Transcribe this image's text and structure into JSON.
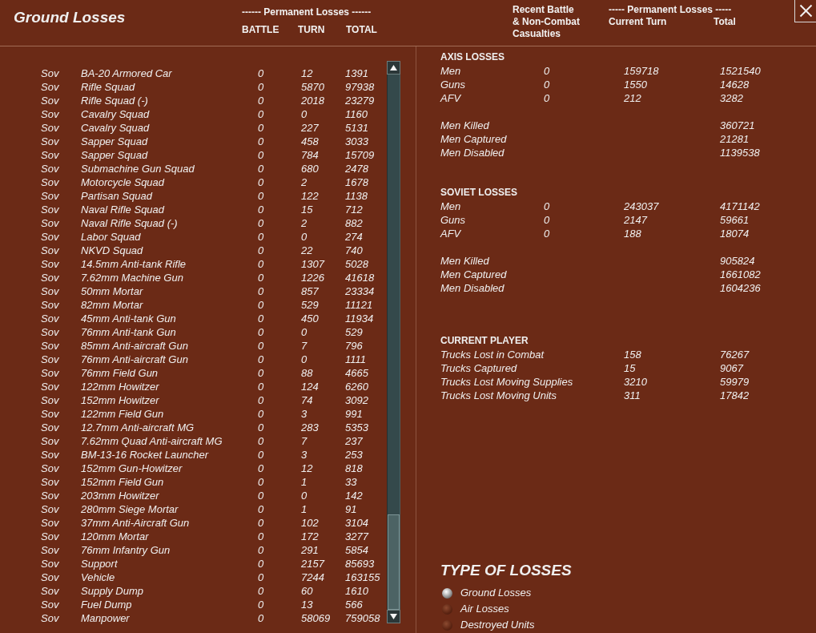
{
  "window": {
    "title": "Ground Losses"
  },
  "unit_losses": {
    "group_label": "------ Permanent Losses ------",
    "columns": [
      "BATTLE",
      "TURN",
      "TOTAL"
    ],
    "rows": [
      {
        "side": "Sov",
        "name": "BA-20 Armored Car",
        "battle": "0",
        "turn": "12",
        "total": "1391"
      },
      {
        "side": "Sov",
        "name": "Rifle Squad",
        "battle": "0",
        "turn": "5870",
        "total": "97938"
      },
      {
        "side": "Sov",
        "name": "Rifle Squad (-)",
        "battle": "0",
        "turn": "2018",
        "total": "23279"
      },
      {
        "side": "Sov",
        "name": "Cavalry Squad",
        "battle": "0",
        "turn": "0",
        "total": "1160"
      },
      {
        "side": "Sov",
        "name": "Cavalry Squad",
        "battle": "0",
        "turn": "227",
        "total": "5131"
      },
      {
        "side": "Sov",
        "name": "Sapper Squad",
        "battle": "0",
        "turn": "458",
        "total": "3033"
      },
      {
        "side": "Sov",
        "name": "Sapper Squad",
        "battle": "0",
        "turn": "784",
        "total": "15709"
      },
      {
        "side": "Sov",
        "name": "Submachine Gun Squad",
        "battle": "0",
        "turn": "680",
        "total": "2478"
      },
      {
        "side": "Sov",
        "name": "Motorcycle Squad",
        "battle": "0",
        "turn": "2",
        "total": "1678"
      },
      {
        "side": "Sov",
        "name": "Partisan Squad",
        "battle": "0",
        "turn": "122",
        "total": "1138"
      },
      {
        "side": "Sov",
        "name": "Naval Rifle Squad",
        "battle": "0",
        "turn": "15",
        "total": "712"
      },
      {
        "side": "Sov",
        "name": "Naval Rifle Squad (-)",
        "battle": "0",
        "turn": "2",
        "total": "882"
      },
      {
        "side": "Sov",
        "name": "Labor Squad",
        "battle": "0",
        "turn": "0",
        "total": "274"
      },
      {
        "side": "Sov",
        "name": "NKVD Squad",
        "battle": "0",
        "turn": "22",
        "total": "740"
      },
      {
        "side": "Sov",
        "name": "14.5mm Anti-tank Rifle",
        "battle": "0",
        "turn": "1307",
        "total": "5028"
      },
      {
        "side": "Sov",
        "name": "7.62mm Machine Gun",
        "battle": "0",
        "turn": "1226",
        "total": "41618"
      },
      {
        "side": "Sov",
        "name": "50mm Mortar",
        "battle": "0",
        "turn": "857",
        "total": "23334"
      },
      {
        "side": "Sov",
        "name": "82mm Mortar",
        "battle": "0",
        "turn": "529",
        "total": "11121"
      },
      {
        "side": "Sov",
        "name": "45mm Anti-tank Gun",
        "battle": "0",
        "turn": "450",
        "total": "11934"
      },
      {
        "side": "Sov",
        "name": "76mm Anti-tank Gun",
        "battle": "0",
        "turn": "0",
        "total": "529"
      },
      {
        "side": "Sov",
        "name": "85mm Anti-aircraft Gun",
        "battle": "0",
        "turn": "7",
        "total": "796"
      },
      {
        "side": "Sov",
        "name": "76mm Anti-aircraft Gun",
        "battle": "0",
        "turn": "0",
        "total": "1111"
      },
      {
        "side": "Sov",
        "name": "76mm Field Gun",
        "battle": "0",
        "turn": "88",
        "total": "4665"
      },
      {
        "side": "Sov",
        "name": "122mm Howitzer",
        "battle": "0",
        "turn": "124",
        "total": "6260"
      },
      {
        "side": "Sov",
        "name": "152mm Howitzer",
        "battle": "0",
        "turn": "74",
        "total": "3092"
      },
      {
        "side": "Sov",
        "name": "122mm Field Gun",
        "battle": "0",
        "turn": "3",
        "total": "991"
      },
      {
        "side": "Sov",
        "name": "12.7mm Anti-aircraft MG",
        "battle": "0",
        "turn": "283",
        "total": "5353"
      },
      {
        "side": "Sov",
        "name": "7.62mm Quad Anti-aircraft MG",
        "battle": "0",
        "turn": "7",
        "total": "237"
      },
      {
        "side": "Sov",
        "name": "BM-13-16 Rocket Launcher",
        "battle": "0",
        "turn": "3",
        "total": "253"
      },
      {
        "side": "Sov",
        "name": "152mm Gun-Howitzer",
        "battle": "0",
        "turn": "12",
        "total": "818"
      },
      {
        "side": "Sov",
        "name": "152mm Field Gun",
        "battle": "0",
        "turn": "1",
        "total": "33"
      },
      {
        "side": "Sov",
        "name": "203mm Howitzer",
        "battle": "0",
        "turn": "0",
        "total": "142"
      },
      {
        "side": "Sov",
        "name": "280mm Siege Mortar",
        "battle": "0",
        "turn": "1",
        "total": "91"
      },
      {
        "side": "Sov",
        "name": "37mm Anti-Aircraft Gun",
        "battle": "0",
        "turn": "102",
        "total": "3104"
      },
      {
        "side": "Sov",
        "name": "120mm Mortar",
        "battle": "0",
        "turn": "172",
        "total": "3277"
      },
      {
        "side": "Sov",
        "name": "76mm Infantry Gun",
        "battle": "0",
        "turn": "291",
        "total": "5854"
      },
      {
        "side": "Sov",
        "name": "Support",
        "battle": "0",
        "turn": "2157",
        "total": "85693"
      },
      {
        "side": "Sov",
        "name": "Vehicle",
        "battle": "0",
        "turn": "7244",
        "total": "163155"
      },
      {
        "side": "Sov",
        "name": "Supply Dump",
        "battle": "0",
        "turn": "60",
        "total": "1610"
      },
      {
        "side": "Sov",
        "name": "Fuel Dump",
        "battle": "0",
        "turn": "13",
        "total": "566"
      },
      {
        "side": "Sov",
        "name": "Manpower",
        "battle": "0",
        "turn": "58069",
        "total": "759058"
      }
    ]
  },
  "summary": {
    "recent_label": [
      "Recent Battle",
      "& Non-Combat",
      "Casualties"
    ],
    "group_label": "----- Permanent Losses -----",
    "columns": [
      "Current Turn",
      "Total"
    ],
    "sections": [
      {
        "title": "AXIS LOSSES",
        "rows": [
          {
            "label": "Men",
            "recent": "0",
            "turn": "159718",
            "total": "1521540"
          },
          {
            "label": "Guns",
            "recent": "0",
            "turn": "1550",
            "total": "14628"
          },
          {
            "label": "AFV",
            "recent": "0",
            "turn": "212",
            "total": "3282"
          }
        ],
        "casualties": [
          {
            "label": "Men Killed",
            "total": "360721"
          },
          {
            "label": "Men Captured",
            "total": "21281"
          },
          {
            "label": "Men Disabled",
            "total": "1139538"
          }
        ]
      },
      {
        "title": "SOVIET LOSSES",
        "rows": [
          {
            "label": "Men",
            "recent": "0",
            "turn": "243037",
            "total": "4171142"
          },
          {
            "label": "Guns",
            "recent": "0",
            "turn": "2147",
            "total": "59661"
          },
          {
            "label": "AFV",
            "recent": "0",
            "turn": "188",
            "total": "18074"
          }
        ],
        "casualties": [
          {
            "label": "Men Killed",
            "total": "905824"
          },
          {
            "label": "Men Captured",
            "total": "1661082"
          },
          {
            "label": "Men Disabled",
            "total": "1604236"
          }
        ]
      },
      {
        "title": "CURRENT PLAYER",
        "rows": [
          {
            "label": "Trucks Lost in Combat",
            "turn": "158",
            "total": "76267"
          },
          {
            "label": "Trucks Captured",
            "turn": "15",
            "total": "9067"
          },
          {
            "label": "Trucks Lost Moving Supplies",
            "turn": "3210",
            "total": "59979"
          },
          {
            "label": "Trucks Lost Moving Units",
            "turn": "311",
            "total": "17842"
          }
        ]
      }
    ]
  },
  "type_of_losses": {
    "title": "TYPE OF LOSSES",
    "options": [
      {
        "label": "Ground Losses",
        "selected": true
      },
      {
        "label": "Air Losses",
        "selected": false
      },
      {
        "label": "Destroyed Units",
        "selected": false
      }
    ]
  }
}
